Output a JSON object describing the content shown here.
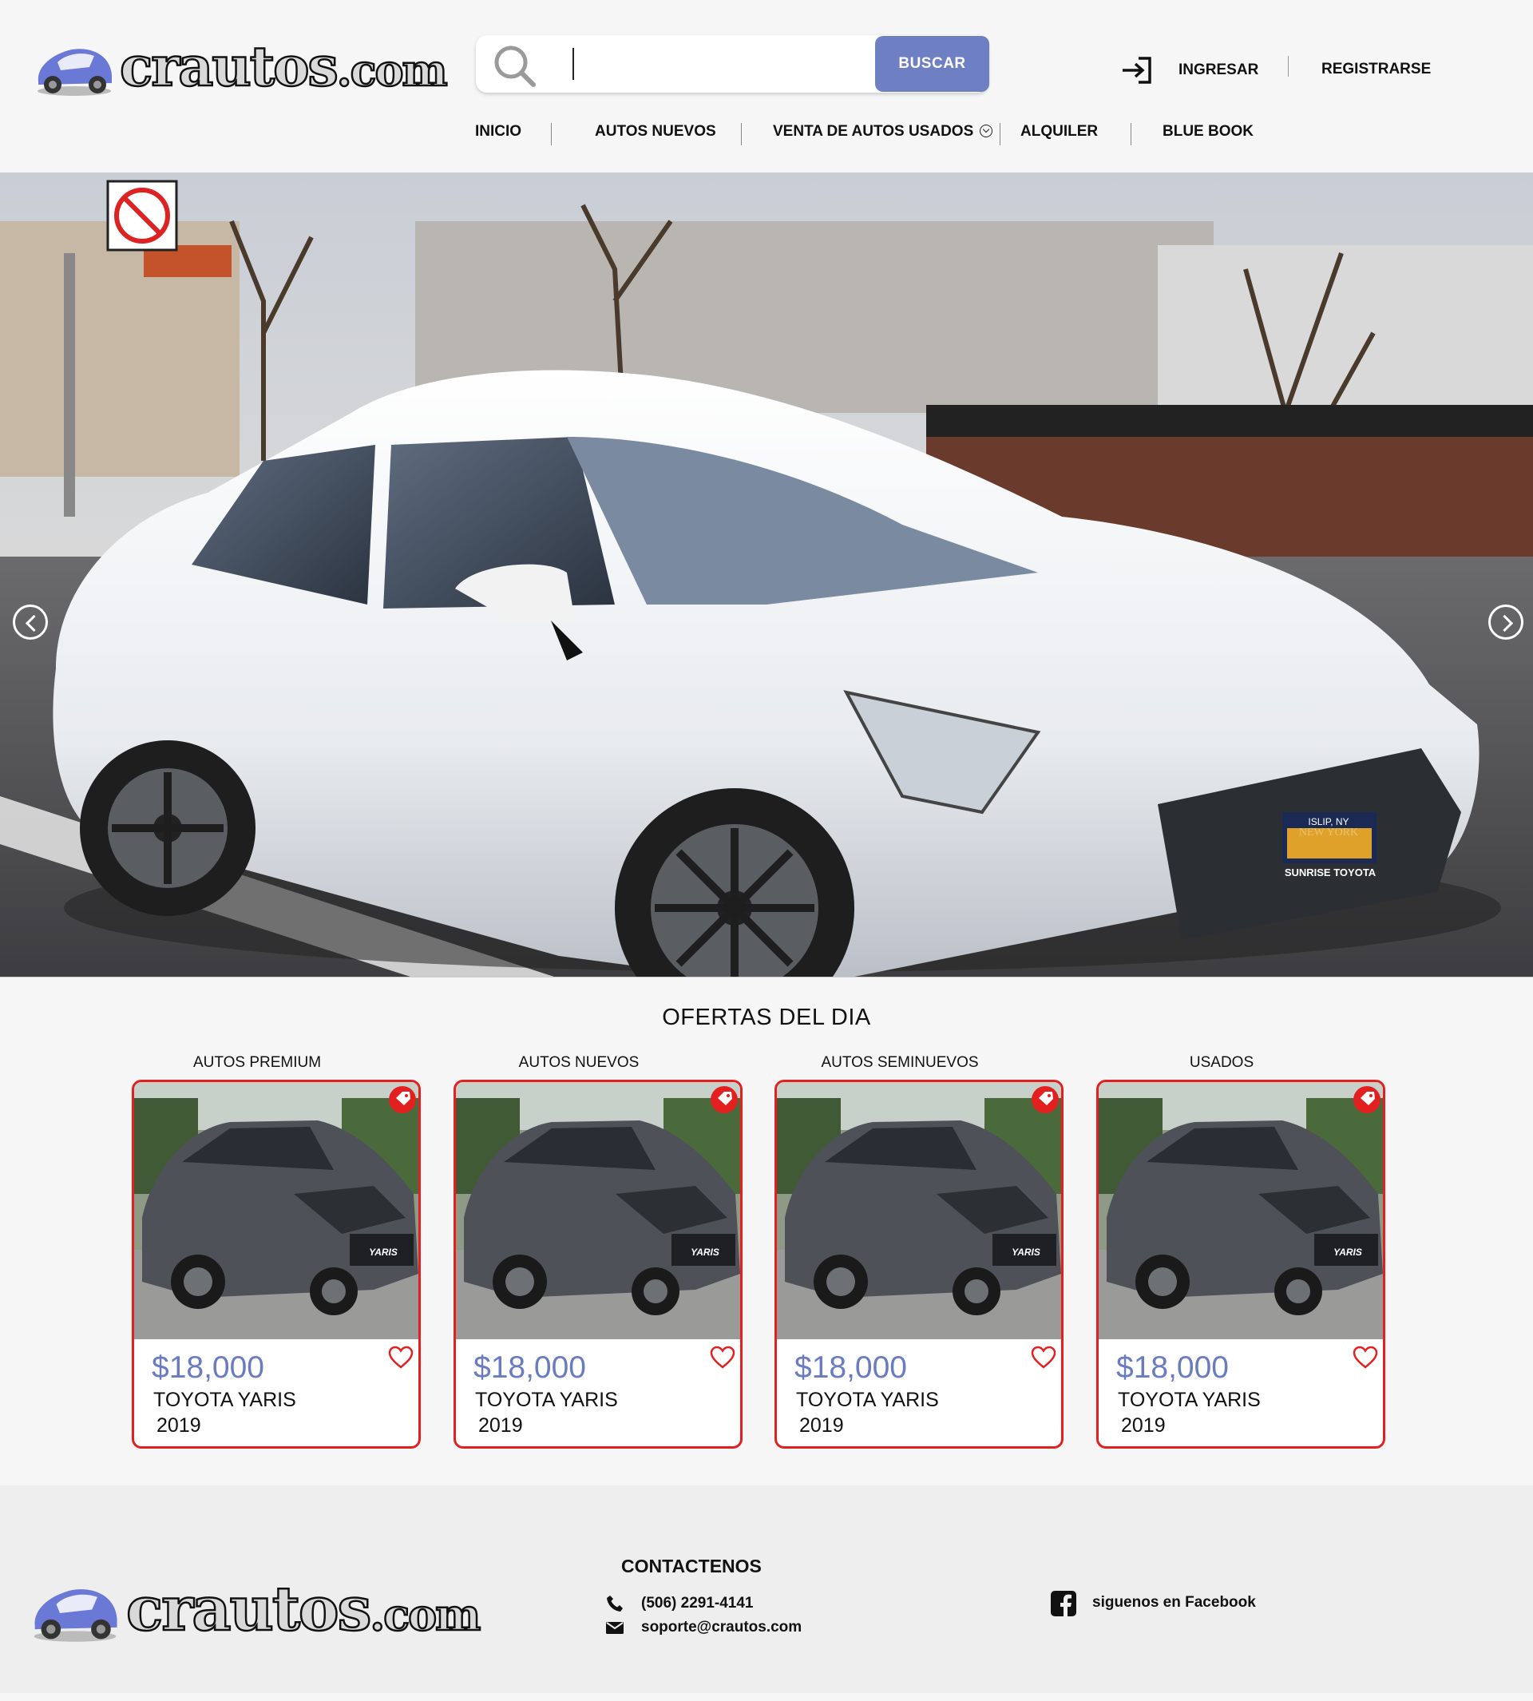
{
  "header": {
    "logo_text": "crautos",
    "logo_suffix": ".com",
    "search": {
      "placeholder": "",
      "value": "",
      "button_label": "BUSCAR"
    },
    "login_label": "INGRESAR",
    "register_label": "REGISTRARSE"
  },
  "nav": {
    "items": [
      {
        "label": "INICIO"
      },
      {
        "label": "AUTOS NUEVOS"
      },
      {
        "label": "VENTA DE AUTOS USADOS",
        "has_dropdown": true
      },
      {
        "label": "ALQUILER"
      },
      {
        "label": "BLUE BOOK"
      }
    ]
  },
  "hero": {
    "plate_top": "ISLIP, NY",
    "plate_state": "NEW YORK",
    "plate_bottom": "SUNRISE TOYOTA"
  },
  "offers": {
    "title": "OFERTAS DEL DIA",
    "cards": [
      {
        "category": "AUTOS PREMIUM",
        "price": "$18,000",
        "model": "TOYOTA YARIS",
        "year": "2019"
      },
      {
        "category": "AUTOS NUEVOS",
        "price": "$18,000",
        "model": "TOYOTA YARIS",
        "year": "2019"
      },
      {
        "category": "AUTOS SEMINUEVOS",
        "price": "$18,000",
        "model": "TOYOTA YARIS",
        "year": "2019"
      },
      {
        "category": "USADOS",
        "price": "$18,000",
        "model": "TOYOTA YARIS",
        "year": "2019"
      }
    ],
    "badge_text": "YARIS"
  },
  "footer": {
    "logo_text": "crautos",
    "logo_suffix": ".com",
    "contact_title": "CONTACTENOS",
    "phone": "(506) 2291-4141",
    "email": "soporte@crautos.com",
    "facebook": "siguenos en Facebook"
  },
  "colors": {
    "accent": "#6e7fc4",
    "price": "#6a7cbf",
    "card_border": "#e32020",
    "background": "#f6f6f6"
  },
  "icons": [
    "search-icon",
    "login-icon",
    "chevron-down-icon",
    "arrow-left-icon",
    "arrow-right-icon",
    "heart-icon",
    "price-tag-icon",
    "phone-icon",
    "mail-icon",
    "facebook-icon"
  ]
}
